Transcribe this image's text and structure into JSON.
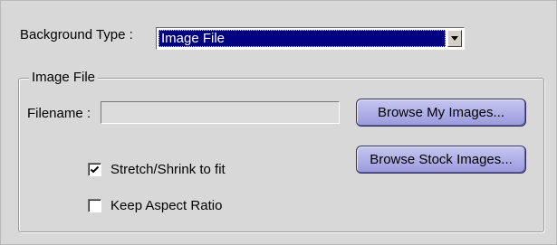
{
  "background_type": {
    "label": "Background Type :",
    "selected": "Image File",
    "dropdown_icon": "chevron-down-icon"
  },
  "image_group": {
    "legend": "Image File",
    "filename": {
      "label": "Filename :",
      "value": ""
    },
    "buttons": {
      "browse_my": "Browse My Images...",
      "browse_stock": "Browse Stock Images..."
    },
    "options": [
      {
        "label": "Stretch/Shrink to fit",
        "checked": true
      },
      {
        "label": "Keep Aspect Ratio",
        "checked": false
      }
    ]
  },
  "colors": {
    "selection": "#000080",
    "button_face": "#a8a8e6",
    "panel": "#d8d8d8"
  }
}
